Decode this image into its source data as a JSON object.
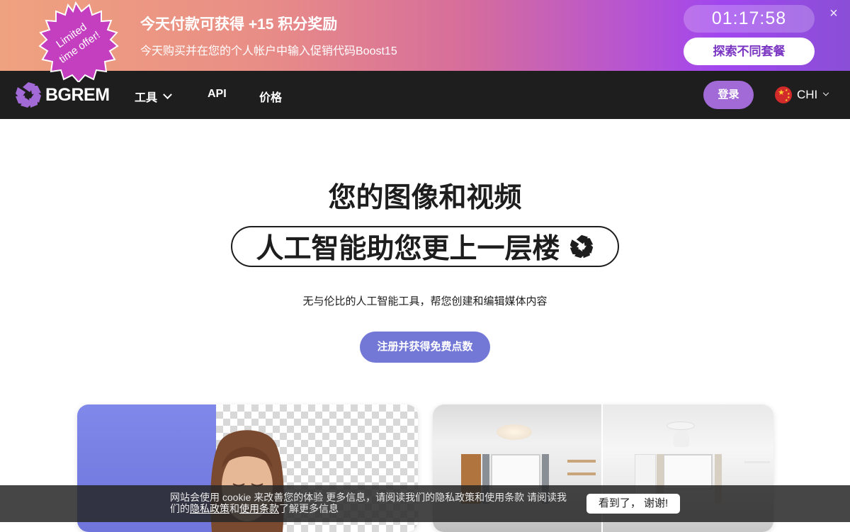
{
  "promo": {
    "badge_line1": "Limited",
    "badge_line2": "time offer!",
    "title": "今天付款可获得 +15 积分奖励",
    "subtitle": "今天购买并在您的个人帐户中输入促销代码Boost15",
    "timer": "01:17:58",
    "explore_label": "探索不同套餐",
    "close_icon": "×",
    "colors": {
      "badge": "#c43fbf",
      "explore_text": "#7a35c2"
    }
  },
  "nav": {
    "logo_text": "BGREM",
    "items": [
      {
        "label": "工具",
        "has_dropdown": true
      },
      {
        "label": "API"
      },
      {
        "label": "价格"
      }
    ],
    "login_label": "登录",
    "language": "CHI",
    "colors": {
      "background": "#1e1e1e",
      "login_bg": "#a26ad6",
      "logo": "#a26ad6"
    }
  },
  "hero": {
    "title": "您的图像和视频",
    "pill_text": "人工智能助您更上一层楼",
    "subtitle": "无与伦比的人工智能工具，帮您创建和编辑媒体内容",
    "cta_label": "注册并获得免费点数",
    "colors": {
      "cta": "#7378d6"
    }
  },
  "cards": [
    {
      "name": "background-removal-example"
    },
    {
      "name": "room-redesign-example"
    }
  ],
  "cookie": {
    "text_before": "网站会使用 cookie 来改善您的体验 更多信息，请阅读我们的隐私政策和使用条款 请阅读我们的",
    "privacy_link": "隐私政策",
    "and": "和",
    "terms_link": "使用条款",
    "text_after": "了解更多信息",
    "accept_label": "看到了， 谢谢!"
  }
}
